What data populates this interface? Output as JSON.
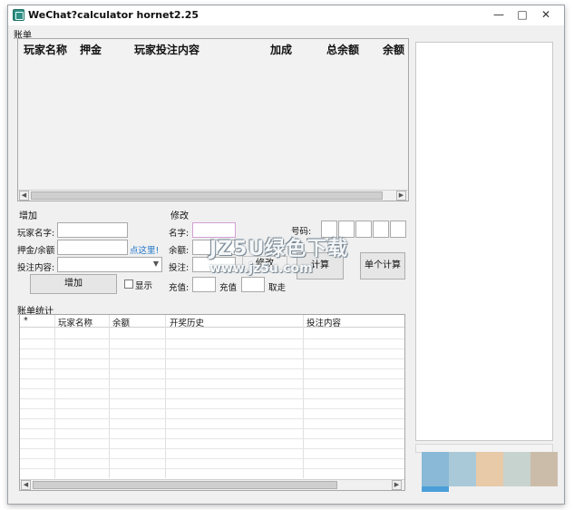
{
  "window": {
    "title": "WeChat?calculator hornet2.25",
    "controls": [
      "—",
      "□",
      "✕"
    ]
  },
  "ledger": {
    "label": "账单",
    "columns": [
      "玩家名称",
      "押金",
      "玩家投注内容",
      "加成",
      "总余额",
      "余额"
    ]
  },
  "add_panel": {
    "label": "增加",
    "player_name_label": "玩家名字:",
    "player_name_value": "",
    "deposit_label": "押金/余额",
    "deposit_value": "",
    "click_here_link": "点这里!",
    "bet_content_label": "投注内容:",
    "bet_content_value": "",
    "add_button": "增加",
    "show_label": "显示"
  },
  "edit_panel": {
    "label": "修改",
    "name_label": "名字:",
    "name_value": "",
    "balance_label": "余额:",
    "balance_value": "",
    "bet_label": "投注:",
    "bet_value": "",
    "edit_button": "修改",
    "recharge_label": "充值:",
    "recharge_value": "",
    "recharge_button": "充值",
    "withdraw_value": "",
    "withdraw_button": "取走"
  },
  "calc_panel": {
    "number_label": "号码:",
    "number_boxes": [
      "",
      "",
      "",
      "",
      ""
    ],
    "calc_button": "计算",
    "single_calc_button": "单个计算"
  },
  "stats": {
    "label": "账单统计",
    "columns": [
      "*",
      "玩家名称",
      "余额",
      "开奖历史",
      "投注内容"
    ]
  },
  "watermark": {
    "line1": "JZ5U绿色下载",
    "line2": "www.jz5u.com"
  },
  "colors": {
    "swatches": [
      "#89b9d6",
      "#a9c9d8",
      "#e8c9a8",
      "#c7d3cf",
      "#cbbcaa"
    ],
    "accent_bar": "#4a9fd8"
  }
}
